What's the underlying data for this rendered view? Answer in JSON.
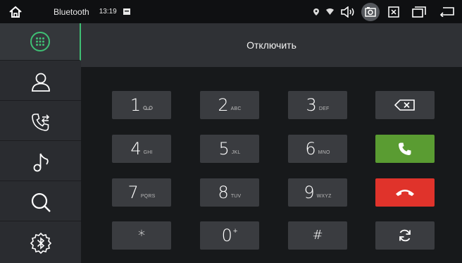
{
  "status_bar": {
    "title": "Bluetooth",
    "time": "13:19",
    "icons": [
      "home-icon",
      "message-icon",
      "location-icon",
      "wifi-icon",
      "volume-icon",
      "screenshot-icon",
      "close-box-icon",
      "recent-apps-icon",
      "back-icon"
    ]
  },
  "sidebar": {
    "items": [
      {
        "name": "dialpad",
        "icon": "dialpad-icon",
        "active": true
      },
      {
        "name": "contacts",
        "icon": "contact-icon"
      },
      {
        "name": "call-log",
        "icon": "call-log-icon"
      },
      {
        "name": "music",
        "icon": "music-icon"
      },
      {
        "name": "search",
        "icon": "search-icon"
      },
      {
        "name": "bluetooth-settings",
        "icon": "bluetooth-settings-icon"
      }
    ]
  },
  "main": {
    "disconnect_label": "Отключить"
  },
  "keypad": {
    "keys": [
      {
        "main": "1",
        "sub": "○○"
      },
      {
        "main": "2",
        "sub": "ABC"
      },
      {
        "main": "3",
        "sub": "DEF"
      },
      {
        "main": "4",
        "sub": "GHI"
      },
      {
        "main": "5",
        "sub": "JKL"
      },
      {
        "main": "6",
        "sub": "MNO"
      },
      {
        "main": "7",
        "sub": "PQRS"
      },
      {
        "main": "8",
        "sub": "TUV"
      },
      {
        "main": "9",
        "sub": "WXYZ"
      },
      {
        "main": "*",
        "sub": ""
      },
      {
        "main": "0",
        "sub": "+"
      },
      {
        "main": "#",
        "sub": ""
      }
    ],
    "colors": {
      "call": "#5a9c32",
      "hangup": "#e0332b",
      "key": "#3a3c40",
      "accent": "#3fbf74"
    }
  }
}
